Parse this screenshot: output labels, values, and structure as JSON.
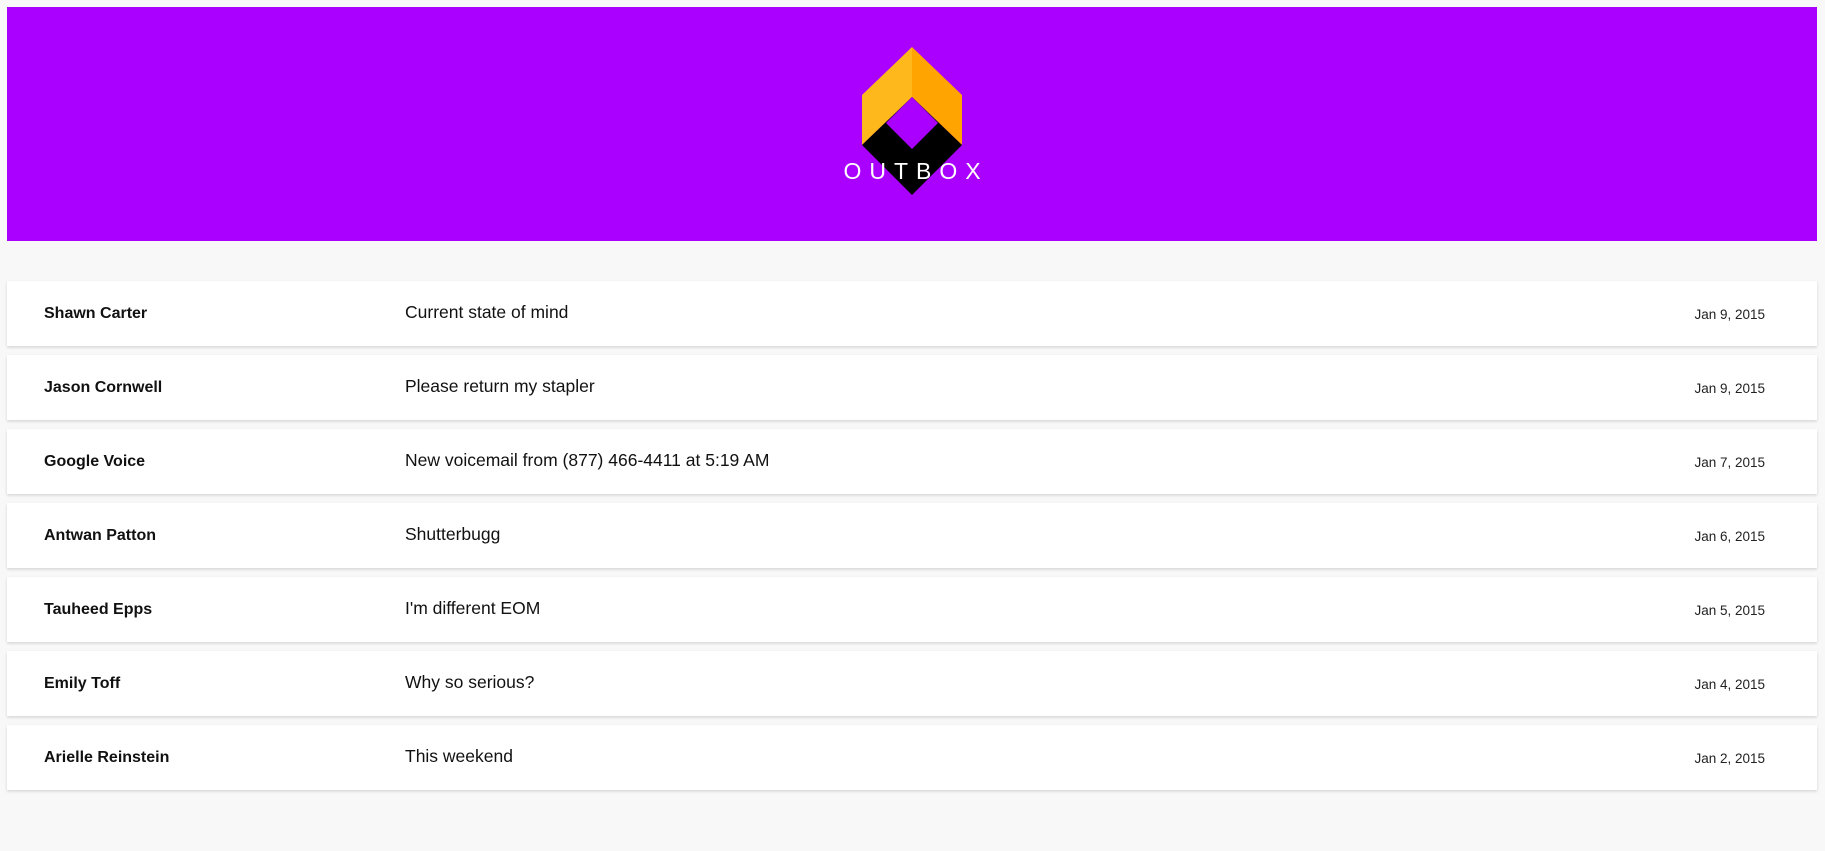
{
  "brand": {
    "name": "OUTBOX",
    "header_color": "#aa00ff",
    "logo_colors": [
      "#ffb81c",
      "#ffa400",
      "#000000"
    ]
  },
  "messages": [
    {
      "sender": "Shawn Carter",
      "subject": "Current state of mind",
      "date": "Jan 9, 2015"
    },
    {
      "sender": "Jason Cornwell",
      "subject": "Please return my stapler",
      "date": "Jan 9, 2015"
    },
    {
      "sender": "Google Voice",
      "subject": "New voicemail from (877) 466-4411 at 5:19 AM",
      "date": "Jan 7, 2015"
    },
    {
      "sender": "Antwan Patton",
      "subject": "Shutterbugg",
      "date": "Jan 6, 2015"
    },
    {
      "sender": "Tauheed Epps",
      "subject": "I'm different EOM",
      "date": "Jan 5, 2015"
    },
    {
      "sender": "Emily Toff",
      "subject": "Why so serious?",
      "date": "Jan 4, 2015"
    },
    {
      "sender": "Arielle Reinstein",
      "subject": "This weekend",
      "date": "Jan 2, 2015"
    }
  ]
}
